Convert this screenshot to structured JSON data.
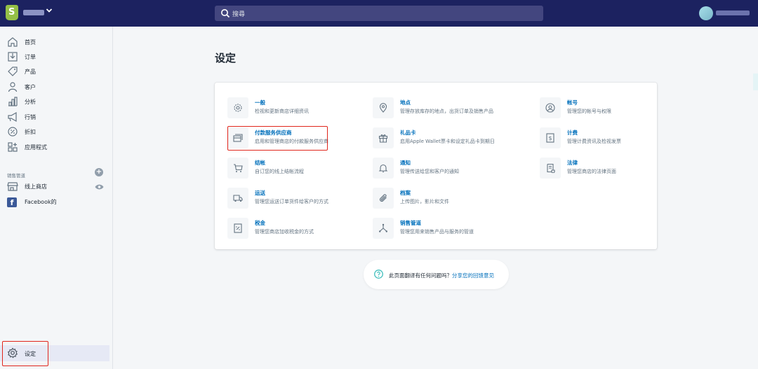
{
  "topbar": {
    "search_placeholder": "搜尋"
  },
  "sidebar": {
    "items": [
      {
        "label": "首页",
        "icon": "home-icon"
      },
      {
        "label": "订单",
        "icon": "orders-icon"
      },
      {
        "label": "产品",
        "icon": "tag-icon"
      },
      {
        "label": "客户",
        "icon": "person-icon"
      },
      {
        "label": "分析",
        "icon": "bar-chart-icon"
      },
      {
        "label": "行销",
        "icon": "megaphone-icon"
      },
      {
        "label": "折扣",
        "icon": "discount-icon"
      },
      {
        "label": "应用程式",
        "icon": "apps-icon"
      }
    ],
    "channels_title": "销售管道",
    "channels": [
      {
        "label": "线上商店",
        "icon": "store-icon"
      },
      {
        "label": "Facebook的",
        "icon": "facebook-icon"
      }
    ],
    "settings_label": "设定"
  },
  "main": {
    "title": "设定",
    "settings": [
      {
        "title": "一般",
        "desc": "检视和更新商店详细资讯",
        "icon": "gear-icon"
      },
      {
        "title": "地点",
        "desc": "管理存放库存的地点，出货订单及销售产品",
        "icon": "location-pin-icon"
      },
      {
        "title": "帐号",
        "desc": "管理您的帐号与权限",
        "icon": "account-icon"
      },
      {
        "title": "付款服务供应商",
        "desc": "启用和管理商店的付款服务供应商",
        "icon": "payment-card-icon"
      },
      {
        "title": "礼品卡",
        "desc": "启用Apple Wallet票卡和设定礼品卡到期日",
        "icon": "gift-icon"
      },
      {
        "title": "计费",
        "desc": "管理计费资讯及检视发票",
        "icon": "billing-icon"
      },
      {
        "title": "结帐",
        "desc": "自订您的线上结帐流程",
        "icon": "cart-icon"
      },
      {
        "title": "通知",
        "desc": "管理传送给您和客户的通知",
        "icon": "bell-icon"
      },
      {
        "title": "法律",
        "desc": "管理您商店的法律页面",
        "icon": "legal-scroll-icon"
      },
      {
        "title": "运送",
        "desc": "管理您运送订单货件给客户的方式",
        "icon": "truck-icon"
      },
      {
        "title": "档案",
        "desc": "上传图片，影片和文件",
        "icon": "paperclip-icon"
      },
      {
        "title": "税金",
        "desc": "管理您商店加收税金的方式",
        "icon": "tax-icon"
      },
      {
        "title": "销售管道",
        "desc": "管理您用来销售产品与服务的管道",
        "icon": "channels-icon"
      }
    ]
  },
  "feedback": {
    "text": "此页面翻译有任何问题吗？",
    "link": "分享您的回馈意见"
  },
  "colors": {
    "topbar": "#1c2260",
    "link": "#006fbb",
    "highlight_box": "#e0261c",
    "shopify_green": "#95bf47"
  }
}
